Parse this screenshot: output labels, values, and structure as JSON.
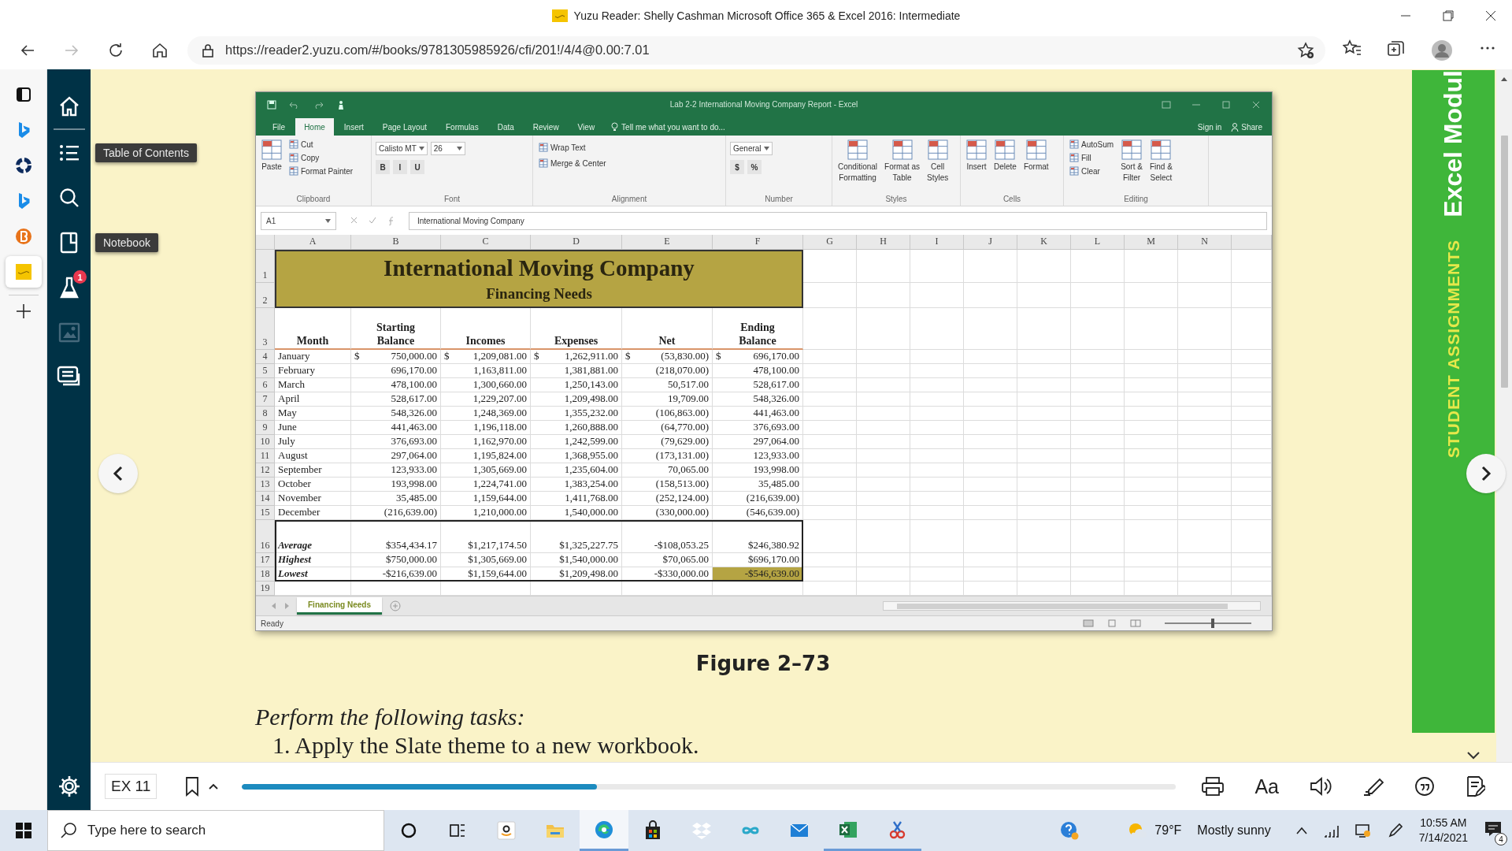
{
  "browser": {
    "title": "Yuzu Reader: Shelly Cashman Microsoft Office 365 & Excel 2016: Intermediate",
    "url": "https://reader2.yuzu.com/#/books/9781305985926/cfi/201!/4/4@0.00:7.01"
  },
  "vertical_tabs": [
    {
      "kind": "window",
      "selected": false
    },
    {
      "kind": "bing",
      "selected": false
    },
    {
      "kind": "ring",
      "selected": false
    },
    {
      "kind": "bing",
      "selected": false
    },
    {
      "kind": "brightspace",
      "selected": false
    },
    {
      "kind": "yuzu",
      "selected": true
    }
  ],
  "reader_sidebar": {
    "items": [
      {
        "kind": "home",
        "disabled": false
      },
      {
        "kind": "contents",
        "disabled": false,
        "tooltip": "Table of Contents"
      },
      {
        "kind": "search",
        "disabled": false
      },
      {
        "kind": "notebook",
        "disabled": false,
        "tooltip": "Notebook"
      },
      {
        "kind": "flask",
        "disabled": false,
        "badge": "1"
      },
      {
        "kind": "image",
        "disabled": true
      },
      {
        "kind": "cards",
        "disabled": false
      }
    ]
  },
  "excel_figure": {
    "title": "Lab 2-2 International Moving Company Report - Excel",
    "account": [
      "Sign in",
      "Share"
    ],
    "tabs": [
      {
        "label": "File",
        "selected": false
      },
      {
        "label": "Home",
        "selected": true
      },
      {
        "label": "Insert",
        "selected": false
      },
      {
        "label": "Page Layout",
        "selected": false
      },
      {
        "label": "Formulas",
        "selected": false
      },
      {
        "label": "Data",
        "selected": false
      },
      {
        "label": "Review",
        "selected": false
      },
      {
        "label": "View",
        "selected": false
      }
    ],
    "tell_me": "Tell me what you want to do...",
    "ribbon": [
      {
        "label": "Clipboard",
        "items": [
          {
            "kind": "large",
            "label": [
              "Paste"
            ]
          },
          {
            "kind": "small",
            "label": "Cut"
          },
          {
            "kind": "small",
            "label": "Copy"
          },
          {
            "kind": "small",
            "label": "Format Painter"
          }
        ]
      },
      {
        "label": "Font",
        "items": [
          [
            {
              "kind": "field",
              "label": "Calisto MT"
            },
            {
              "kind": "field",
              "label": "26"
            }
          ],
          [
            {
              "kind": "key",
              "label": "B"
            },
            {
              "kind": "key",
              "label": "I"
            },
            {
              "kind": "key",
              "label": "U"
            }
          ]
        ]
      },
      {
        "label": "Alignment",
        "items": [
          [
            {
              "kind": "small",
              "label": "Wrap Text"
            }
          ],
          [
            {
              "kind": "small",
              "label": "Merge & Center"
            }
          ]
        ]
      },
      {
        "label": "Number",
        "items": [
          [
            {
              "kind": "field",
              "label": "General"
            }
          ],
          [
            {
              "kind": "key",
              "label": "$"
            },
            {
              "kind": "key",
              "label": "%"
            }
          ]
        ]
      },
      {
        "label": "Styles",
        "items": [
          {
            "kind": "large",
            "label": [
              "Conditional",
              "Formatting"
            ]
          },
          {
            "kind": "large",
            "label": [
              "Format as",
              "Table"
            ]
          },
          {
            "kind": "large",
            "label": [
              "Cell",
              "Styles"
            ]
          }
        ]
      },
      {
        "label": "Cells",
        "items": [
          {
            "kind": "large",
            "label": [
              "Insert"
            ]
          },
          {
            "kind": "large",
            "label": [
              "Delete"
            ]
          },
          {
            "kind": "large",
            "label": [
              "Format"
            ]
          }
        ]
      },
      {
        "label": "Editing",
        "items": [
          {
            "kind": "small",
            "label": "AutoSum"
          },
          {
            "kind": "small",
            "label": "Fill"
          },
          {
            "kind": "small",
            "label": "Clear"
          },
          {
            "kind": "large",
            "label": [
              "Sort &",
              "Filter"
            ]
          },
          {
            "kind": "large",
            "label": [
              "Find &",
              "Select"
            ]
          }
        ]
      }
    ],
    "name_box": "A1",
    "formula": "International Moving Company",
    "columns": [
      "A",
      "B",
      "C",
      "D",
      "E",
      "F",
      "G",
      "H",
      "I",
      "J",
      "K",
      "L",
      "M",
      "N"
    ],
    "sheet": {
      "title": "International Moving Company",
      "subtitle": "Financing Needs",
      "top_rows": [
        "1",
        "2",
        "3"
      ],
      "headers": [
        [
          "Month"
        ],
        [
          "Starting",
          "Balance"
        ],
        [
          "Incomes"
        ],
        [
          "Expenses"
        ],
        [
          "Net"
        ],
        [
          "Ending",
          "Balance"
        ]
      ],
      "months": [
        {
          "row": "4",
          "label": "January",
          "cells": [
            [
              "$",
              "750,000.00"
            ],
            [
              "$",
              "1,209,081.00"
            ],
            [
              "$",
              "1,262,911.00"
            ],
            [
              "$",
              "(53,830.00)"
            ],
            [
              "$",
              "696,170.00"
            ]
          ]
        },
        {
          "row": "5",
          "label": "February",
          "cells": [
            "696,170.00",
            "1,163,811.00",
            "1,381,881.00",
            "(218,070.00)",
            "478,100.00"
          ]
        },
        {
          "row": "6",
          "label": "March",
          "cells": [
            "478,100.00",
            "1,300,660.00",
            "1,250,143.00",
            "50,517.00",
            "528,617.00"
          ]
        },
        {
          "row": "7",
          "label": "April",
          "cells": [
            "528,617.00",
            "1,229,207.00",
            "1,209,498.00",
            "19,709.00",
            "548,326.00"
          ]
        },
        {
          "row": "8",
          "label": "May",
          "cells": [
            "548,326.00",
            "1,248,369.00",
            "1,355,232.00",
            "(106,863.00)",
            "441,463.00"
          ]
        },
        {
          "row": "9",
          "label": "June",
          "cells": [
            "441,463.00",
            "1,196,118.00",
            "1,260,888.00",
            "(64,770.00)",
            "376,693.00"
          ]
        },
        {
          "row": "10",
          "label": "July",
          "cells": [
            "376,693.00",
            "1,162,970.00",
            "1,242,599.00",
            "(79,629.00)",
            "297,064.00"
          ]
        },
        {
          "row": "11",
          "label": "August",
          "cells": [
            "297,064.00",
            "1,195,824.00",
            "1,368,955.00",
            "(173,131.00)",
            "123,933.00"
          ]
        },
        {
          "row": "12",
          "label": "September",
          "cells": [
            "123,933.00",
            "1,305,669.00",
            "1,235,604.00",
            "70,065.00",
            "193,998.00"
          ]
        },
        {
          "row": "13",
          "label": "October",
          "cells": [
            "193,998.00",
            "1,224,741.00",
            "1,383,254.00",
            "(158,513.00)",
            "35,485.00"
          ]
        },
        {
          "row": "14",
          "label": "November",
          "cells": [
            "35,485.00",
            "1,159,644.00",
            "1,411,768.00",
            "(252,124.00)",
            "(216,639.00)"
          ]
        },
        {
          "row": "15",
          "label": "December",
          "cells": [
            "(216,639.00)",
            "1,210,000.00",
            "1,540,000.00",
            "(330,000.00)",
            "(546,639.00)"
          ]
        }
      ],
      "summary": [
        {
          "row": "16",
          "label": "Average",
          "cells": [
            {
              "value": "$354,434.17",
              "highlighted": false
            },
            {
              "value": "$1,217,174.50",
              "highlighted": false
            },
            {
              "value": "$1,325,227.75",
              "highlighted": false
            },
            {
              "value": "-$108,053.25",
              "highlighted": false
            },
            {
              "value": "$246,380.92",
              "highlighted": false
            }
          ]
        },
        {
          "row": "17",
          "label": "Highest",
          "cells": [
            {
              "value": "$750,000.00",
              "highlighted": false
            },
            {
              "value": "$1,305,669.00",
              "highlighted": false
            },
            {
              "value": "$1,540,000.00",
              "highlighted": false
            },
            {
              "value": "$70,065.00",
              "highlighted": false
            },
            {
              "value": "$696,170.00",
              "highlighted": false
            }
          ]
        },
        {
          "row": "18",
          "label": "Lowest",
          "cells": [
            {
              "value": "-$216,639.00",
              "highlighted": false
            },
            {
              "value": "$1,159,644.00",
              "highlighted": false
            },
            {
              "value": "$1,209,498.00",
              "highlighted": false
            },
            {
              "value": "-$330,000.00",
              "highlighted": false
            },
            {
              "value": "-$546,639.00",
              "highlighted": true
            }
          ]
        }
      ],
      "last_row": "19"
    },
    "sheet_tabs": [
      {
        "label": "Financing Needs",
        "selected": true
      }
    ],
    "status": "Ready",
    "zoom": {
      "level": 0.55
    }
  },
  "caption": "Figure 2–73",
  "instructions": {
    "heading": "Perform the following tasks:",
    "steps": [
      "1. Apply the Slate theme to a new workbook."
    ]
  },
  "side_tab": {
    "title": "Excel Modul",
    "subtitle": "STUDENT ASSIGNMENTS"
  },
  "bottom_bar": {
    "page": "EX 11",
    "progress": {
      "level": 0.38
    },
    "font_button": "Aa"
  },
  "taskbar": {
    "search": {
      "placeholder": "Type here to search"
    },
    "apps": [
      {
        "kind": "amazon",
        "running": false,
        "active": false
      },
      {
        "kind": "explorer",
        "running": false,
        "active": false
      },
      {
        "kind": "edge",
        "running": true,
        "active": true
      },
      {
        "kind": "store",
        "running": false,
        "active": false
      },
      {
        "kind": "dropbox",
        "running": false,
        "active": false
      },
      {
        "kind": "infinity",
        "running": false,
        "active": false
      },
      {
        "kind": "mail",
        "running": false,
        "active": false
      },
      {
        "kind": "excel",
        "running": true,
        "active": false
      },
      {
        "kind": "snip",
        "running": true,
        "active": false
      }
    ],
    "temperature": "79°F",
    "weather": "Mostly sunny",
    "time": "10:55 AM",
    "date": "7/14/2021",
    "notifications": "4"
  }
}
